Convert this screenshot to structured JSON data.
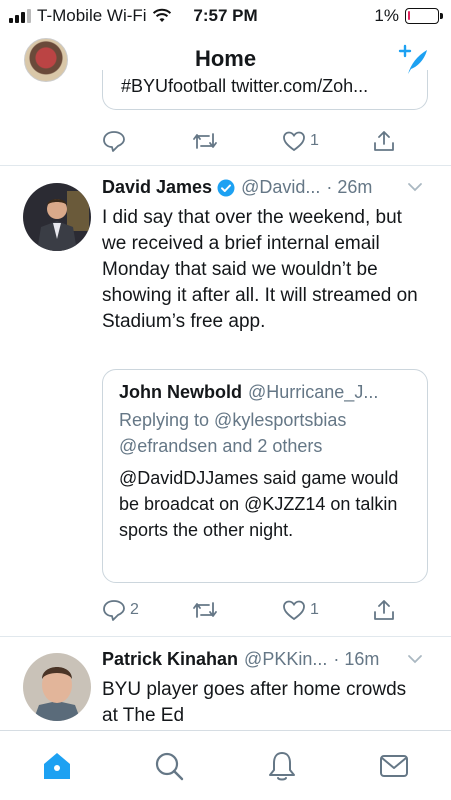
{
  "status_bar": {
    "carrier": "T-Mobile Wi-Fi",
    "time": "7:57 PM",
    "battery": "1%"
  },
  "header": {
    "title": "Home"
  },
  "partial_quote": {
    "text": "#BYUfootball twitter.com/Zoh..."
  },
  "prev_actions": {
    "likes": "1"
  },
  "tweet1": {
    "name": "David James",
    "handle": "@David...",
    "time": "· 26m",
    "text": "I did say that over the weekend, but we received a brief internal email Monday that said we wouldn’t be showing it after all. It will streamed on Stadium’s free app.",
    "quote": {
      "name": "John Newbold",
      "handle": "@Hurricane_J...",
      "reply": "Replying to @kylesportsbias @efrandsen and 2 others",
      "text": "@DavidDJJames said game would be broadcat on @KJZZ14 on talkin sports the other night."
    },
    "replies": "2",
    "likes": "1"
  },
  "tweet2": {
    "name": "Patrick Kinahan",
    "handle": "@PKKin...",
    "time": "· 16m",
    "text": "BYU player goes after home crowds at The Ed"
  },
  "colors": {
    "accent": "#1da1f2",
    "muted": "#657786",
    "border": "#e1e8ed",
    "verified": "#1da1f2"
  },
  "icons": [
    "wifi-icon",
    "compose-tweet-icon",
    "reply-icon",
    "retweet-icon",
    "like-icon",
    "share-icon",
    "verified-badge-icon",
    "chevron-down-icon",
    "home-icon",
    "search-icon",
    "notifications-icon",
    "messages-icon"
  ]
}
